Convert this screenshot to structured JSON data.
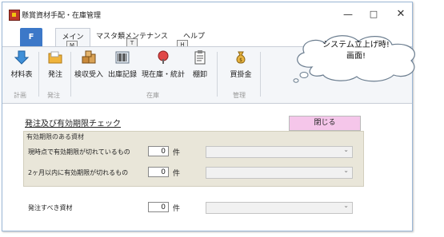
{
  "window": {
    "title": "懸賞資材手配・在庫管理",
    "controls": {
      "minimize": "—",
      "maximize": "□",
      "close": "✕"
    }
  },
  "ribbon": {
    "file_tab": "F",
    "tabs": [
      {
        "label": "メイン",
        "keytip": "M",
        "active": true
      },
      {
        "label": "マスタ類メンテナンス",
        "keytip": "T"
      },
      {
        "label": "ヘルプ",
        "keytip": "H"
      }
    ],
    "buttons": [
      {
        "label": "材料表",
        "icon": "down-arrow-icon"
      },
      {
        "label": "発注",
        "icon": "folder-icon"
      },
      {
        "label": "検収受入",
        "icon": "boxes-icon"
      },
      {
        "label": "出庫記録",
        "icon": "barcode-icon"
      },
      {
        "label": "現在庫・統計",
        "icon": "chart-icon"
      },
      {
        "label": "棚卸",
        "icon": "clipboard-icon"
      },
      {
        "label": "買掛金",
        "icon": "moneybag-icon"
      }
    ],
    "groups": [
      "計画",
      "発注",
      "在庫",
      "管理"
    ]
  },
  "form": {
    "title": "発注及び有効期限チェック",
    "close_label": "閉じる",
    "panel_header": "有効期限のある資材",
    "rows": [
      {
        "label": "現時点で有効期限が切れているもの",
        "value": "0",
        "unit": "件"
      },
      {
        "label": "2ヶ月以内に有効期限が切れるもの",
        "value": "0",
        "unit": "件"
      }
    ],
    "order_row": {
      "label": "発注すべき資材",
      "value": "0",
      "unit": "件"
    }
  },
  "callout": {
    "line1": "システム立上げ時!",
    "line2": "画面!"
  },
  "colors": {
    "file_tab": "#3c78c8",
    "close_button": "#f5c6ea",
    "panel": "#e9e6d9"
  }
}
